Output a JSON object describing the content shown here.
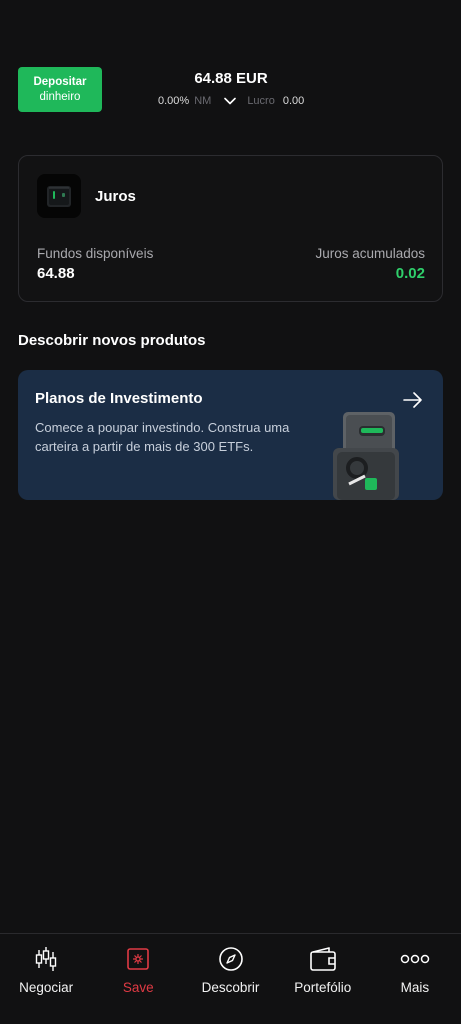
{
  "header": {
    "deposit_button": {
      "line1": "Depositar",
      "line2": "dinheiro"
    },
    "balance": "64.88 EUR",
    "change_percent": "0.00%",
    "period": "NM",
    "profit_label": "Lucro",
    "profit_value": "0.00"
  },
  "juros_card": {
    "title": "Juros",
    "available_label": "Fundos disponíveis",
    "available_value": "64.88",
    "accrued_label": "Juros acumulados",
    "accrued_value": "0.02"
  },
  "discover": {
    "section_title": "Descobrir novos produtos",
    "card_title": "Planos de Investimento",
    "card_description": "Comece a poupar investindo. Construa uma carteira a partir de mais de 300 ETFs."
  },
  "bottom_nav": {
    "items": [
      {
        "label": "Negociar",
        "icon": "candlestick-icon",
        "active": false
      },
      {
        "label": "Save",
        "icon": "safe-icon",
        "active": true
      },
      {
        "label": "Descobrir",
        "icon": "compass-icon",
        "active": false
      },
      {
        "label": "Portefólio",
        "icon": "wallet-icon",
        "active": false
      },
      {
        "label": "Mais",
        "icon": "more-dots-icon",
        "active": false
      }
    ]
  },
  "colors": {
    "background": "#111112",
    "accent_green": "#1fb85a",
    "positive": "#2fcf6b",
    "active_nav": "#e03a44",
    "promo_card": "#1b2d45"
  }
}
